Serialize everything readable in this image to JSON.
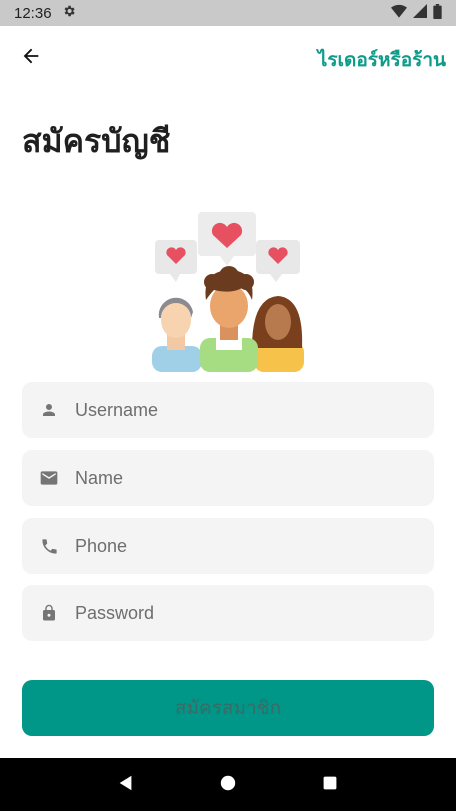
{
  "status_bar": {
    "time": "12:36",
    "icons": [
      "settings-icon",
      "wifi-icon",
      "signal-icon",
      "battery-icon"
    ]
  },
  "app_bar": {
    "back_icon": "arrow-back-icon",
    "switch_link_label": "ไรเดอร์หรือร้าน"
  },
  "page_title": "สมัครบัญชี",
  "form": {
    "username_placeholder": "Username",
    "name_placeholder": "Name",
    "phone_placeholder": "Phone",
    "password_placeholder": "Password",
    "username_icon": "person-icon",
    "name_icon": "email-icon",
    "phone_icon": "phone-icon",
    "password_icon": "lock-icon"
  },
  "submit_label": "สมัครสมาชิก",
  "colors": {
    "accent": "#0f9b8a",
    "button": "#009688",
    "field_bg": "#f4f4f4",
    "status_bar": "#c9c9c9"
  },
  "nav": [
    "back-triangle-icon",
    "home-circle-icon",
    "recents-square-icon"
  ]
}
